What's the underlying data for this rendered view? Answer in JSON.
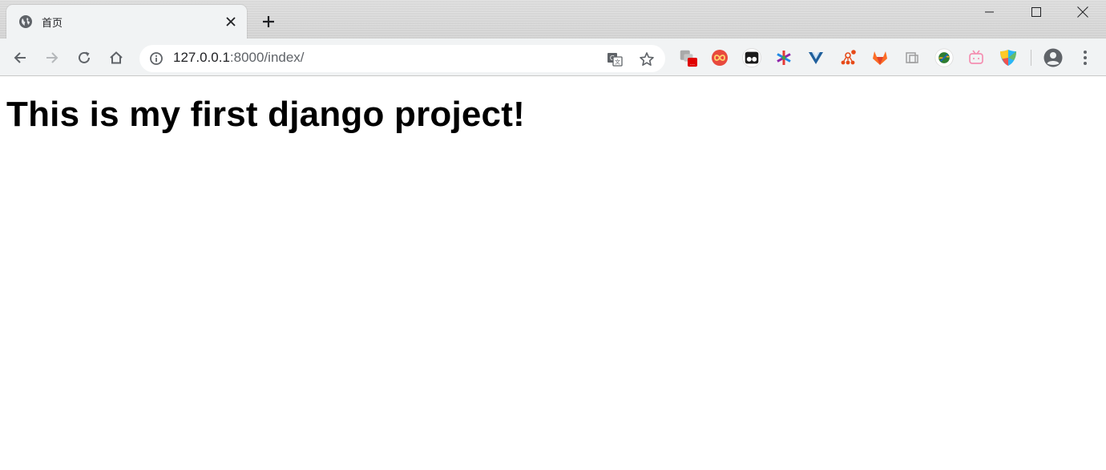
{
  "browser": {
    "tab": {
      "title": "首页",
      "close_glyph": "✕",
      "favicon": "globe-icon"
    },
    "new_tab_glyph": "+",
    "window_controls": [
      "minimize-icon",
      "maximize-icon",
      "close-icon"
    ],
    "address_bar": {
      "host": "127.0.0.1",
      "rest": ":8000/index/",
      "left_icon": "info-icon",
      "right_icons": [
        "translate-icon",
        "bookmark-star-icon"
      ]
    },
    "nav_icons": [
      "back-arrow-icon",
      "forward-arrow-icon",
      "reload-icon",
      "home-icon"
    ],
    "extensions": [
      "extension-red-badge-icon",
      "extension-infinity-icon",
      "extension-tampermonkey-icon",
      "extension-asterisk-icon",
      "extension-vue-devtools-icon",
      "extension-graph-icon",
      "extension-gitlab-fox-icon",
      "extension-clipboard-icon",
      "extension-globe-green-icon",
      "extension-bilibili-tv-icon",
      "extension-shield-colored-icon"
    ],
    "extension_badge_text": "...",
    "colors": {
      "accent_red": "#e00000",
      "toolbar_bg": "#f1f3f4",
      "titlebar_bg": "#d6d6d6"
    }
  },
  "page": {
    "heading": "This is my first django project!"
  }
}
